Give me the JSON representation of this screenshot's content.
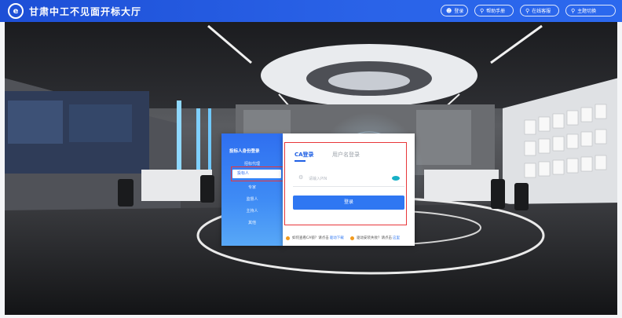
{
  "header": {
    "logo_text": "e",
    "title": "甘肃中工不见面开标大厅",
    "buttons": [
      {
        "icon": "user-icon",
        "label": "登录"
      },
      {
        "icon": "search-icon",
        "label": "帮助手册"
      },
      {
        "icon": "search-icon",
        "label": "在线客服"
      },
      {
        "icon": "search-icon",
        "label": "主题切换"
      }
    ]
  },
  "sidebar": {
    "title": "投标人身份登录",
    "items": [
      "招标代理",
      "投标人",
      "专家",
      "监督人",
      "主持人",
      "其他"
    ]
  },
  "login": {
    "tabs": {
      "ca": "CA登录",
      "password": "用户名登录"
    },
    "pin_placeholder": "请输入PIN",
    "login_button": "登录"
  },
  "footer": {
    "note1_text": "如何查看CA锁？请点击",
    "note1_link": "驱动下载",
    "note2_text": "驱动安装失败？请点击",
    "note2_link": "这里"
  },
  "colors": {
    "primary": "#2f77f2",
    "header": "#2a63e8",
    "highlight": "#e8373a",
    "eye": "#17b0c6",
    "warn": "#f29a1d"
  }
}
